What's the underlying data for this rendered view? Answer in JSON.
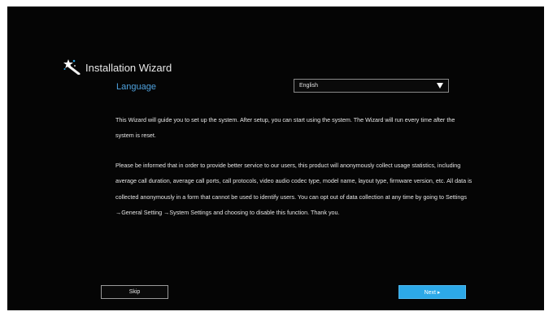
{
  "wizard": {
    "title": "Installation Wizard",
    "icon": "magic-wand-icon"
  },
  "language": {
    "label": "Language",
    "selected": "English",
    "label_color": "#4fa3e0"
  },
  "intro_text": "This Wizard will guide you to set up the system. After setup, you can start using the system. The Wizard will run every time after the system is reset.",
  "privacy_text": "Please be informed that in order to provide better service to our users, this product will anonymously collect usage statistics, including average call duration, average call ports, call protocols, video audio codec type, model name, layout type, firmware version, etc. All data is collected anonymously in a form that cannot be used to identify users. You can opt out of data collection at any time by going to Settings →General Setting →System Settings and choosing to disable this function. Thank you.",
  "buttons": {
    "skip": "Skip",
    "next": "Next ▸"
  },
  "colors": {
    "background": "#050505",
    "accent": "#2da9e8"
  }
}
